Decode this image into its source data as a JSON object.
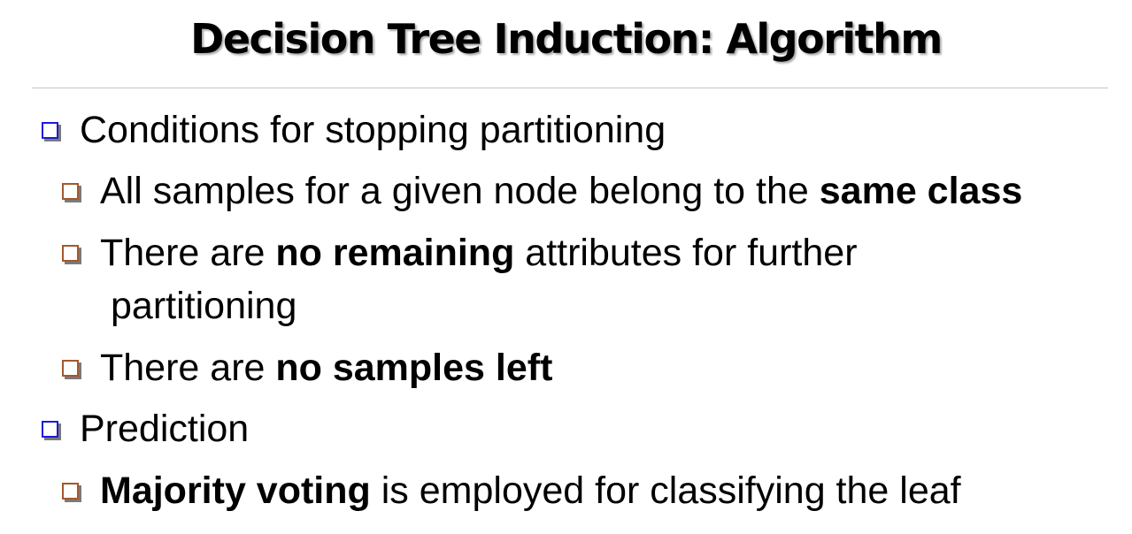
{
  "slide": {
    "title": "Decision Tree Induction: Algorithm",
    "bullets": {
      "conditions": "Conditions for stopping partitioning",
      "same_class_prefix": "All samples for a given node belong to the ",
      "same_class_bold": "same class",
      "no_remaining_prefix": "There are ",
      "no_remaining_bold": "no remaining",
      "no_remaining_suffix": " attributes for further",
      "no_remaining_cont": "partitioning",
      "no_samples_prefix": "There are ",
      "no_samples_bold": "no samples left",
      "prediction": "Prediction",
      "majority_bold": "Majority voting",
      "majority_suffix": " is employed for classifying the leaf"
    }
  },
  "colors": {
    "level1_bullet": "#1c1cd6",
    "level2_bullet": "#a5582b",
    "rule": "#c7c7c7"
  }
}
